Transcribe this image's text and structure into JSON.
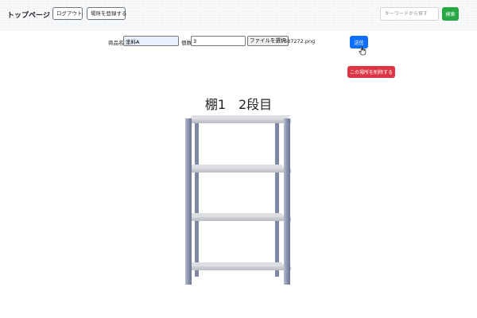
{
  "navbar": {
    "brand": "トップページ",
    "logout_label": "ログアウト",
    "register_location_label": "場所を登録する",
    "search_placeholder": "キーワードから探す",
    "search_value": "",
    "search_button_label": "検索"
  },
  "form": {
    "name_label": "商品名",
    "name_value": "塗料A",
    "quantity_label": "個数",
    "quantity_value": "3",
    "file_button_label": "ファイルを選択",
    "file_name": "687272.png",
    "submit_label": "送信"
  },
  "delete_label": "この場所を削除する",
  "shelf": {
    "title": "棚1　2段目",
    "shelf_levels": 4,
    "frame_color": "#8e97b1",
    "board_color": "#c9cbd0"
  },
  "colors": {
    "primary": "#0d6efd",
    "success": "#28a745",
    "danger": "#dc3545"
  },
  "icons": {
    "cursor": "pointer-hand-icon"
  }
}
